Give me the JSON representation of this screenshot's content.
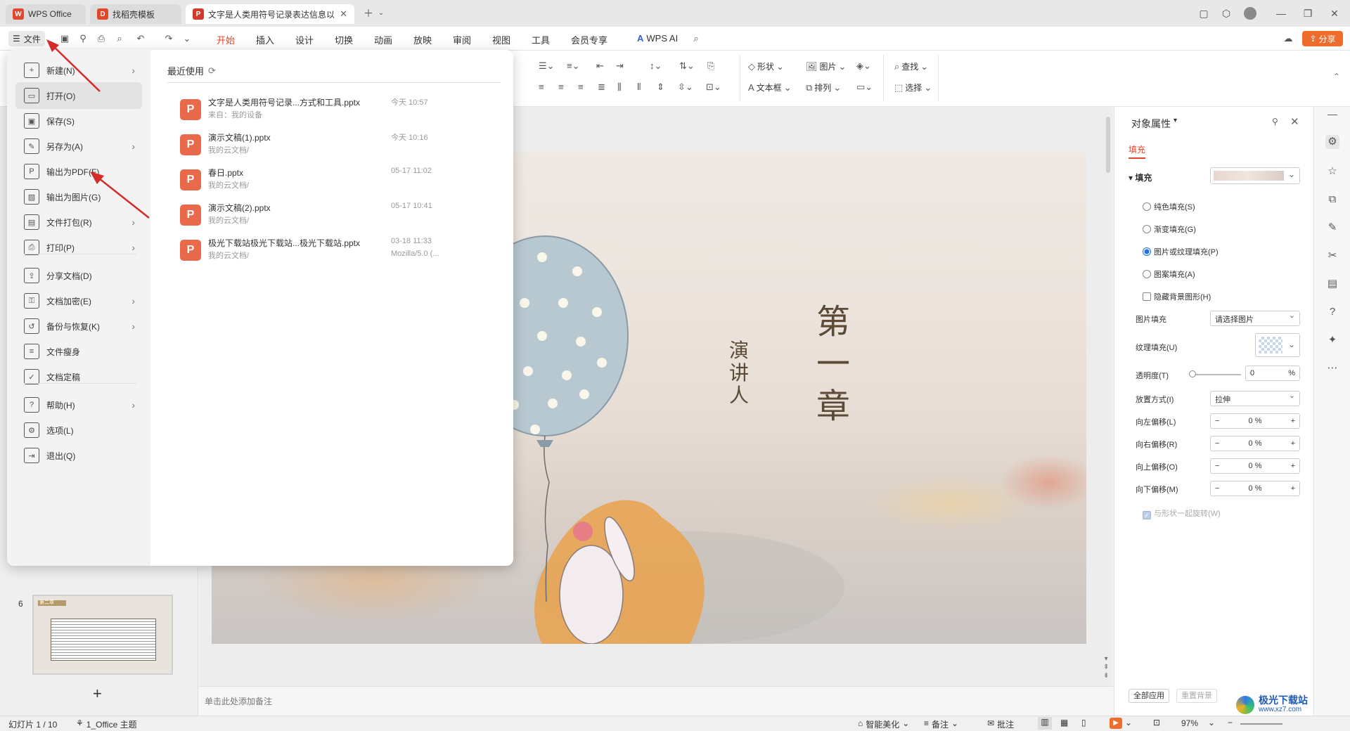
{
  "tabs": [
    {
      "label": "WPS Office"
    },
    {
      "label": "找稻壳模板"
    },
    {
      "label": "文字是人类用符号记录表达信息以"
    }
  ],
  "menubar": {
    "file_label": "文件",
    "items": [
      "开始",
      "插入",
      "设计",
      "切换",
      "动画",
      "放映",
      "审阅",
      "视图",
      "工具",
      "会员专享"
    ],
    "active": "开始",
    "wps_ai": "WPS AI",
    "share": "分享"
  },
  "ribbon": {
    "shape": "形状",
    "picture": "图片",
    "find": "查找",
    "textbox": "文本框",
    "arrange": "排列",
    "select": "选择"
  },
  "file_menu": {
    "items": [
      {
        "label": "新建(N)",
        "icon": "new-icon",
        "arrow": true
      },
      {
        "label": "打开(O)",
        "icon": "folder-icon",
        "arrow": false,
        "highlight": true
      },
      {
        "label": "保存(S)",
        "icon": "save-icon",
        "arrow": false
      },
      {
        "label": "另存为(A)",
        "icon": "save-as-icon",
        "arrow": true
      },
      {
        "label": "输出为PDF(F)",
        "icon": "pdf-icon",
        "arrow": false
      },
      {
        "label": "输出为图片(G)",
        "icon": "image-icon",
        "arrow": false
      },
      {
        "label": "文件打包(R)",
        "icon": "package-icon",
        "arrow": true
      },
      {
        "label": "打印(P)",
        "icon": "print-icon",
        "arrow": true
      },
      {
        "label": "分享文档(D)",
        "icon": "share-icon",
        "arrow": false
      },
      {
        "label": "文档加密(E)",
        "icon": "lock-icon",
        "arrow": true
      },
      {
        "label": "备份与恢复(K)",
        "icon": "backup-icon",
        "arrow": true
      },
      {
        "label": "文件瘦身",
        "icon": "slim-icon",
        "arrow": false
      },
      {
        "label": "文档定稿",
        "icon": "finalize-icon",
        "arrow": false
      },
      {
        "label": "帮助(H)",
        "icon": "help-icon",
        "arrow": true
      },
      {
        "label": "选项(L)",
        "icon": "options-icon",
        "arrow": false
      },
      {
        "label": "退出(Q)",
        "icon": "exit-icon",
        "arrow": false
      }
    ],
    "recent_title": "最近使用",
    "recent": [
      {
        "name": "文字是人类用符号记录...方式和工具.pptx",
        "source": "来自：我的设备",
        "time": "今天 10:57",
        "time2": ""
      },
      {
        "name": "演示文稿(1).pptx",
        "source": "我的云文档/",
        "time": "今天 10:16",
        "time2": ""
      },
      {
        "name": "春日.pptx",
        "source": "我的云文档/",
        "time": "05-17 11:02",
        "time2": ""
      },
      {
        "name": "演示文稿(2).pptx",
        "source": "我的云文档/",
        "time": "05-17 10:41",
        "time2": ""
      },
      {
        "name": "极光下载站极光下载站...极光下载站.pptx",
        "source": "我的云文档/",
        "time": "03-18 11:33",
        "time2": "Mozilla/5.0 (..."
      }
    ]
  },
  "slides_panel": {
    "thumb_number": "6",
    "thumb_title": "第二章",
    "add": "+"
  },
  "slide": {
    "title_chars": [
      "第",
      "一",
      "章"
    ],
    "speaker_chars": [
      "演",
      "讲",
      "人"
    ]
  },
  "notes_placeholder": "单击此处添加备注",
  "right_panel": {
    "title": "对象属性",
    "tab": "填充",
    "section": "填充",
    "options": [
      {
        "label": "纯色填充(S)",
        "selected": false
      },
      {
        "label": "渐变填充(G)",
        "selected": false
      },
      {
        "label": "图片或纹理填充(P)",
        "selected": true
      },
      {
        "label": "图案填充(A)",
        "selected": false
      }
    ],
    "hide_bg": "隐藏背景图形(H)",
    "pic_fill_label": "图片填充",
    "pic_fill_value": "请选择图片",
    "texture_label": "纹理填充(U)",
    "transparency_label": "透明度(T)",
    "transparency_value": "0",
    "transparency_unit": "%",
    "placement_label": "放置方式(I)",
    "placement_value": "拉伸",
    "offsets": [
      {
        "label": "向左偏移(L)",
        "value": "0 %"
      },
      {
        "label": "向右偏移(R)",
        "value": "0 %"
      },
      {
        "label": "向上偏移(O)",
        "value": "0 %"
      },
      {
        "label": "向下偏移(M)",
        "value": "0 %"
      }
    ],
    "rotate_with_shape": "与形状一起旋转(W)",
    "apply_all": "全部应用",
    "reset_bg": "重置背景"
  },
  "status": {
    "slide_info": "幻灯片 1 / 10",
    "theme": "1_Office 主题",
    "beautify": "智能美化",
    "notes": "备注",
    "comments": "批注",
    "zoom": "97%"
  },
  "watermark": {
    "name": "极光下载站",
    "url": "www.xz7.com"
  },
  "colors": {
    "accent": "#e1462a",
    "ppt_icon": "#e96a4a",
    "selected_radio": "#1f6fe5",
    "annotation_arrow": "#d42a2a"
  }
}
